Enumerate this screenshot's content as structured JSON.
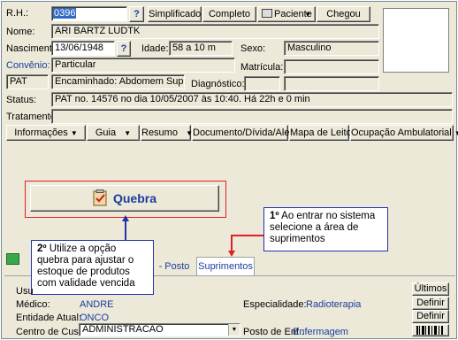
{
  "header": {
    "rh_label": "R.H.:",
    "rh_value": "0396",
    "help_button": "?",
    "simplificado": "Simplificado",
    "completo": "Completo",
    "paciente": "Paciente",
    "chegou": "Chegou",
    "nome_label": "Nome:",
    "nome_value": "ARI BARTZ LUDTK",
    "nascimento_label": "Nascimento:",
    "nascimento_value": "13/06/1948",
    "idade_label": "Idade:",
    "idade_value": "58 a 10 m",
    "sexo_label": "Sexo:",
    "sexo_value": "Masculino",
    "convenio_label": "Convênio:",
    "convenio_value": "Particular",
    "matricula_label": "Matrícula:",
    "pat_value": "PAT",
    "encaminhado_value": "Encaminhado: Abdomem Superior",
    "diagnostico_label": "Diagnóstico:",
    "status_label": "Status:",
    "status_value": "PAT no. 14576 no dia 10/05/2007  às  10:40. Há 22h e 0 min",
    "tratamento_label": "Tratamento:"
  },
  "menubar": {
    "informacoes": "Informações",
    "guia": "Guia",
    "resumo": "Resumo",
    "documento": "Documento/Dívida/Alerta",
    "mapa": "Mapa de Leitos",
    "ocupacao": "Ocupação Ambulatorial"
  },
  "quebra_button": "Quebra",
  "callout1": "1º Ao entrar no sistema selecione a área de suprimentos",
  "callout1_num": "1º",
  "callout1_text": " Ao entrar no sistema selecione a área de suprimentos",
  "callout2_num": "2º",
  "callout2_text": " Utilize a opção quebra para ajustar o estoque de produtos com validade vencida",
  "tabs": {
    "posto": "- Posto",
    "suprimentos": "Suprimentos"
  },
  "bottom": {
    "usu_label": "Usu",
    "ultimos": "Últimos",
    "medico_label": "Médico:",
    "medico_value": "ANDRE",
    "especialidade_label": "Especialidade:",
    "especialidade_value": "Radioterapia",
    "definir1": "Definir",
    "entidade_label": "Entidade Atual:",
    "entidade_value": "ONCO",
    "definir2": "Definir",
    "centro_label": "Centro de Custo:",
    "centro_value": "ADMINISTRACAO",
    "posto_label": "Posto de Enf.:",
    "posto_value": "Enfermagem"
  },
  "colors": {
    "accent_blue": "#1a3ca0",
    "callout_border": "#2233aa",
    "highlight_red": "#e02020",
    "selection": "#316ac5"
  }
}
